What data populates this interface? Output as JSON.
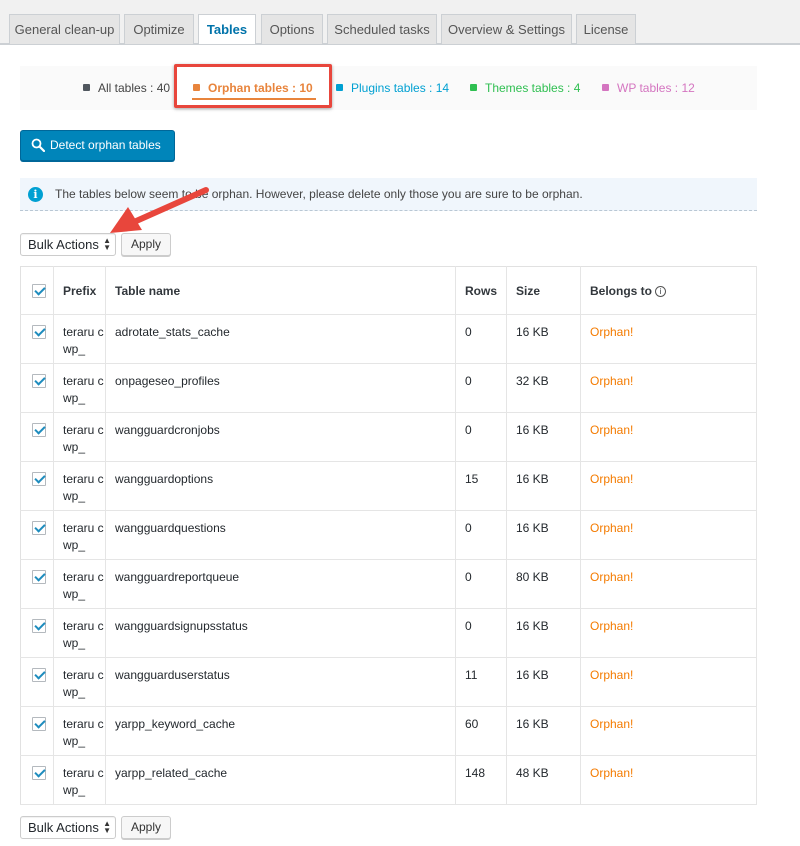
{
  "tabs": [
    {
      "label": "General clean-up",
      "active": false
    },
    {
      "label": "Optimize",
      "active": false
    },
    {
      "label": "Tables",
      "active": true
    },
    {
      "label": "Options",
      "active": false
    },
    {
      "label": "Scheduled tasks",
      "active": false
    },
    {
      "label": "Overview & Settings",
      "active": false
    },
    {
      "label": "License",
      "active": false
    }
  ],
  "filters": {
    "all": {
      "label": "All tables : 40",
      "color": "#444444"
    },
    "orphan": {
      "label": "Orphan tables : 10",
      "color": "#e8843c"
    },
    "plugins": {
      "label": "Plugins tables : 14",
      "color": "#00a0d2"
    },
    "themes": {
      "label": "Themes tables : 4",
      "color": "#2fbf51"
    },
    "wp": {
      "label": "WP tables : 12",
      "color": "#d475c0"
    }
  },
  "detect_button": {
    "label": "Detect orphan tables",
    "icon": "search-icon"
  },
  "notice": {
    "text": "The tables below seem to be orphan. However, please delete only those you are sure to be orphan.",
    "icon": "info-icon"
  },
  "bulk_actions": {
    "label": "Bulk Actions",
    "apply_label": "Apply"
  },
  "table": {
    "headers": {
      "prefix": "Prefix",
      "table_name": "Table name",
      "rows": "Rows",
      "size": "Size",
      "belongs_to": "Belongs to"
    },
    "rows": [
      {
        "prefix": "teraru cwp_",
        "name": "adrotate_stats_cache",
        "rows": "0",
        "size": "16 KB",
        "belongs": "Orphan!",
        "checked": true
      },
      {
        "prefix": "teraru cwp_",
        "name": "onpageseo_profiles",
        "rows": "0",
        "size": "32 KB",
        "belongs": "Orphan!",
        "checked": true
      },
      {
        "prefix": "teraru cwp_",
        "name": "wangguardcronjobs",
        "rows": "0",
        "size": "16 KB",
        "belongs": "Orphan!",
        "checked": true
      },
      {
        "prefix": "teraru cwp_",
        "name": "wangguardoptions",
        "rows": "15",
        "size": "16 KB",
        "belongs": "Orphan!",
        "checked": true
      },
      {
        "prefix": "teraru cwp_",
        "name": "wangguardquestions",
        "rows": "0",
        "size": "16 KB",
        "belongs": "Orphan!",
        "checked": true
      },
      {
        "prefix": "teraru cwp_",
        "name": "wangguardreportqueue",
        "rows": "0",
        "size": "80 KB",
        "belongs": "Orphan!",
        "checked": true
      },
      {
        "prefix": "teraru cwp_",
        "name": "wangguardsignupsstatus",
        "rows": "0",
        "size": "16 KB",
        "belongs": "Orphan!",
        "checked": true
      },
      {
        "prefix": "teraru cwp_",
        "name": "wangguarduserstatus",
        "rows": "11",
        "size": "16 KB",
        "belongs": "Orphan!",
        "checked": true
      },
      {
        "prefix": "teraru cwp_",
        "name": "yarpp_keyword_cache",
        "rows": "60",
        "size": "16 KB",
        "belongs": "Orphan!",
        "checked": true
      },
      {
        "prefix": "teraru cwp_",
        "name": "yarpp_related_cache",
        "rows": "148",
        "size": "48 KB",
        "belongs": "Orphan!",
        "checked": true
      }
    ]
  },
  "colors": {
    "accent": "#0073aa",
    "button": "#0085ba",
    "orphan": "#f47b00",
    "annotation": "#e8463c"
  }
}
